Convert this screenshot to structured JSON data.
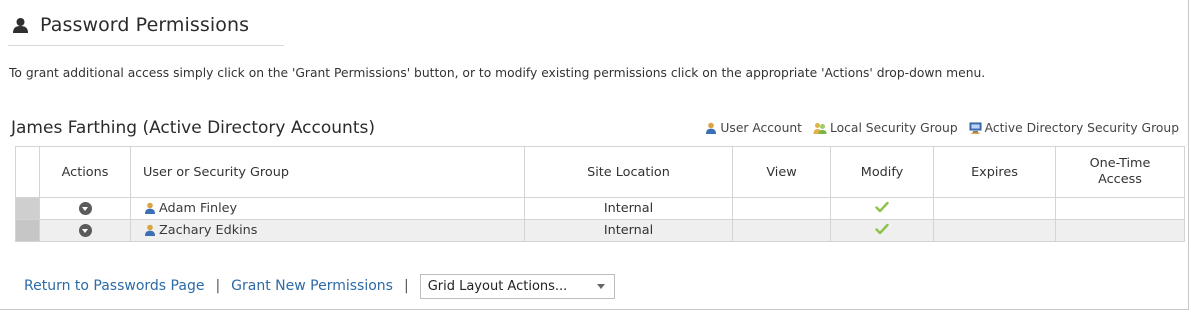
{
  "header": {
    "title": "Password Permissions",
    "icon": "user-silhouette-icon"
  },
  "instructions": "To grant additional access simply click on the 'Grant Permissions' button, or to modify existing permissions click on the appropriate 'Actions' drop-down menu.",
  "section": {
    "title": "James Farthing (Active Directory Accounts)"
  },
  "legend": {
    "user_account": "User Account",
    "local_group": "Local Security Group",
    "ad_group": "Active Directory Security Group"
  },
  "table": {
    "headers": {
      "actions": "Actions",
      "user": "User or Security Group",
      "site": "Site Location",
      "view": "View",
      "modify": "Modify",
      "expires": "Expires",
      "one_time": "One-Time Access"
    },
    "rows": [
      {
        "name": "Adam Finley",
        "site": "Internal",
        "view": "",
        "modify": "✔",
        "expires": "",
        "one_time": ""
      },
      {
        "name": "Zachary Edkins",
        "site": "Internal",
        "view": "",
        "modify": "✔",
        "expires": "",
        "one_time": ""
      }
    ]
  },
  "footer": {
    "return_link": "Return to Passwords Page",
    "separator": "|",
    "grant_link": "Grant New Permissions",
    "grid_select_value": "Grid Layout Actions..."
  },
  "colors": {
    "link": "#2d6aa6",
    "check": "#8bc34a",
    "selector": "#cfcfcf"
  }
}
